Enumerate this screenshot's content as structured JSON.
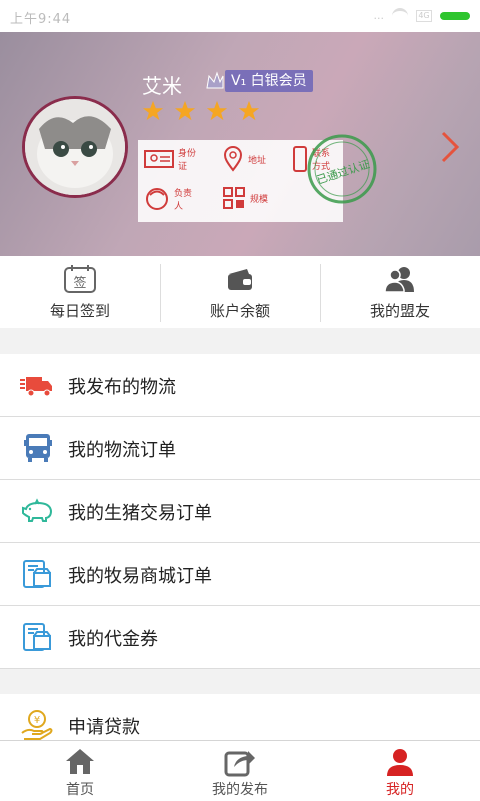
{
  "status_bar": {
    "time": "上午9:44",
    "signal": "...",
    "battery_box": "4G"
  },
  "profile": {
    "name": "艾米",
    "member_level": "V₁ 白银会员",
    "star_count": 4,
    "info_items": [
      "身份证",
      "地址",
      "联系方式",
      "负责人",
      "规模"
    ],
    "stamp_text": "已通过认证"
  },
  "quick_actions": [
    {
      "label": "每日签到",
      "icon": "calendar-sign-icon",
      "icon_text": "签"
    },
    {
      "label": "账户余额",
      "icon": "wallet-icon"
    },
    {
      "label": "我的盟友",
      "icon": "friends-icon"
    }
  ],
  "menu": [
    {
      "label": "我发布的物流",
      "icon": "delivery-truck-icon"
    },
    {
      "label": "我的物流订单",
      "icon": "bus-truck-icon"
    },
    {
      "label": "我的生猪交易订单",
      "icon": "pig-icon"
    },
    {
      "label": "我的牧易商城订单",
      "icon": "shop-order-icon"
    },
    {
      "label": "我的代金券",
      "icon": "voucher-icon"
    }
  ],
  "menu2": [
    {
      "label": "申请贷款",
      "icon": "loan-coin-icon"
    }
  ],
  "tabs": [
    {
      "label": "首页",
      "icon": "home-icon"
    },
    {
      "label": "我的发布",
      "icon": "share-icon"
    },
    {
      "label": "我的",
      "icon": "user-icon",
      "active": true
    }
  ],
  "colors": {
    "accent": "#d62222",
    "vip_badge": "#7a6fb8",
    "star": "#f5a623",
    "stamp": "#3a9a4a"
  }
}
